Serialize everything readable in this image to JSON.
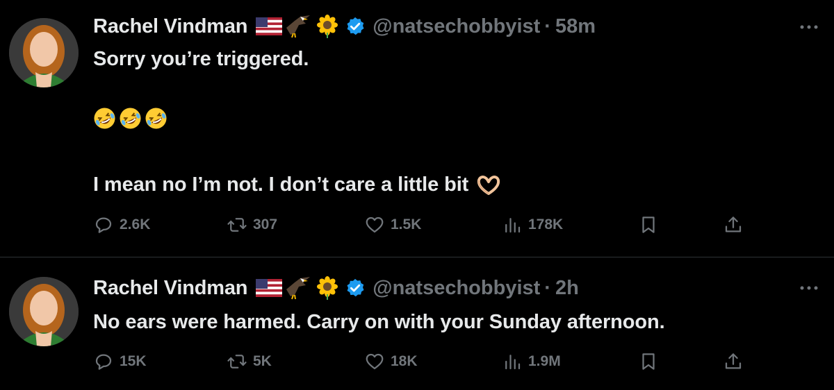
{
  "colors": {
    "background": "#000000",
    "text_primary": "#e7e9ea",
    "text_secondary": "#71767b",
    "verified_blue": "#1d9bf0",
    "divider": "#2f3336"
  },
  "tweets": [
    {
      "author_name": "Rachel Vindman",
      "badges": [
        "us-flag-emoji",
        "eagle-emoji",
        "sunflower-emoji",
        "verified-badge-icon"
      ],
      "handle": "@natsechobbyist",
      "separator": "·",
      "time": "58m",
      "body_lines": [
        "Sorry you’re triggered.",
        "🤣🤣🤣",
        "I mean no I’m not. I don’t care a little bit"
      ],
      "emojis": [
        "rolling-laughing-emoji",
        "rolling-laughing-emoji",
        "rolling-laughing-emoji",
        "heart-hands-emoji"
      ],
      "stats": {
        "replies": "2.6K",
        "reposts": "307",
        "likes": "1.5K",
        "views": "178K"
      }
    },
    {
      "author_name": "Rachel Vindman",
      "badges": [
        "us-flag-emoji",
        "eagle-emoji",
        "sunflower-emoji",
        "verified-badge-icon"
      ],
      "handle": "@natsechobbyist",
      "separator": "·",
      "time": "2h",
      "body_lines": [
        "No ears were harmed. Carry on with your Sunday afternoon."
      ],
      "stats": {
        "replies": "15K",
        "reposts": "5K",
        "likes": "18K",
        "views": "1.9M"
      }
    }
  ]
}
